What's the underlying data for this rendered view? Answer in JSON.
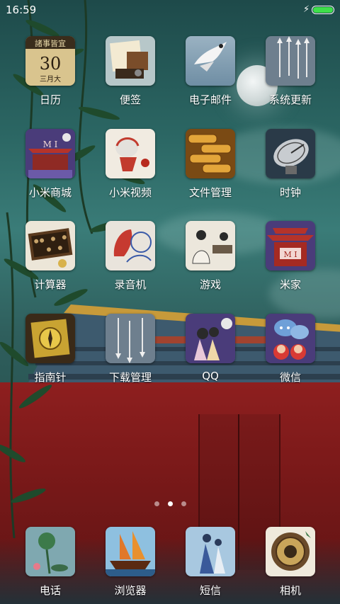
{
  "status_bar": {
    "time": "16:59",
    "charging_icon": "lightning-icon",
    "battery_color": "#3ee04a",
    "battery_level": 1.0
  },
  "apps": [
    {
      "label": "日历",
      "icon": "calendar-icon",
      "detail": {
        "top": "諸事皆宜",
        "day": "30",
        "bottom": "三月大"
      }
    },
    {
      "label": "便签",
      "icon": "notes-icon"
    },
    {
      "label": "电子邮件",
      "icon": "email-icon"
    },
    {
      "label": "系统更新",
      "icon": "system-update-icon"
    },
    {
      "label": "小米商城",
      "icon": "mi-store-icon"
    },
    {
      "label": "小米视频",
      "icon": "mi-video-icon"
    },
    {
      "label": "文件管理",
      "icon": "file-manager-icon"
    },
    {
      "label": "时钟",
      "icon": "clock-icon"
    },
    {
      "label": "计算器",
      "icon": "calculator-icon"
    },
    {
      "label": "录音机",
      "icon": "recorder-icon"
    },
    {
      "label": "游戏",
      "icon": "games-icon"
    },
    {
      "label": "米家",
      "icon": "mi-home-icon"
    },
    {
      "label": "指南针",
      "icon": "compass-icon"
    },
    {
      "label": "下载管理",
      "icon": "downloads-icon"
    },
    {
      "label": "QQ",
      "icon": "qq-icon"
    },
    {
      "label": "微信",
      "icon": "wechat-icon"
    }
  ],
  "page_indicator": {
    "pages": 3,
    "current": 2
  },
  "dock": [
    {
      "label": "电话",
      "icon": "phone-icon"
    },
    {
      "label": "浏览器",
      "icon": "browser-icon"
    },
    {
      "label": "短信",
      "icon": "messages-icon"
    },
    {
      "label": "相机",
      "icon": "camera-icon"
    }
  ]
}
